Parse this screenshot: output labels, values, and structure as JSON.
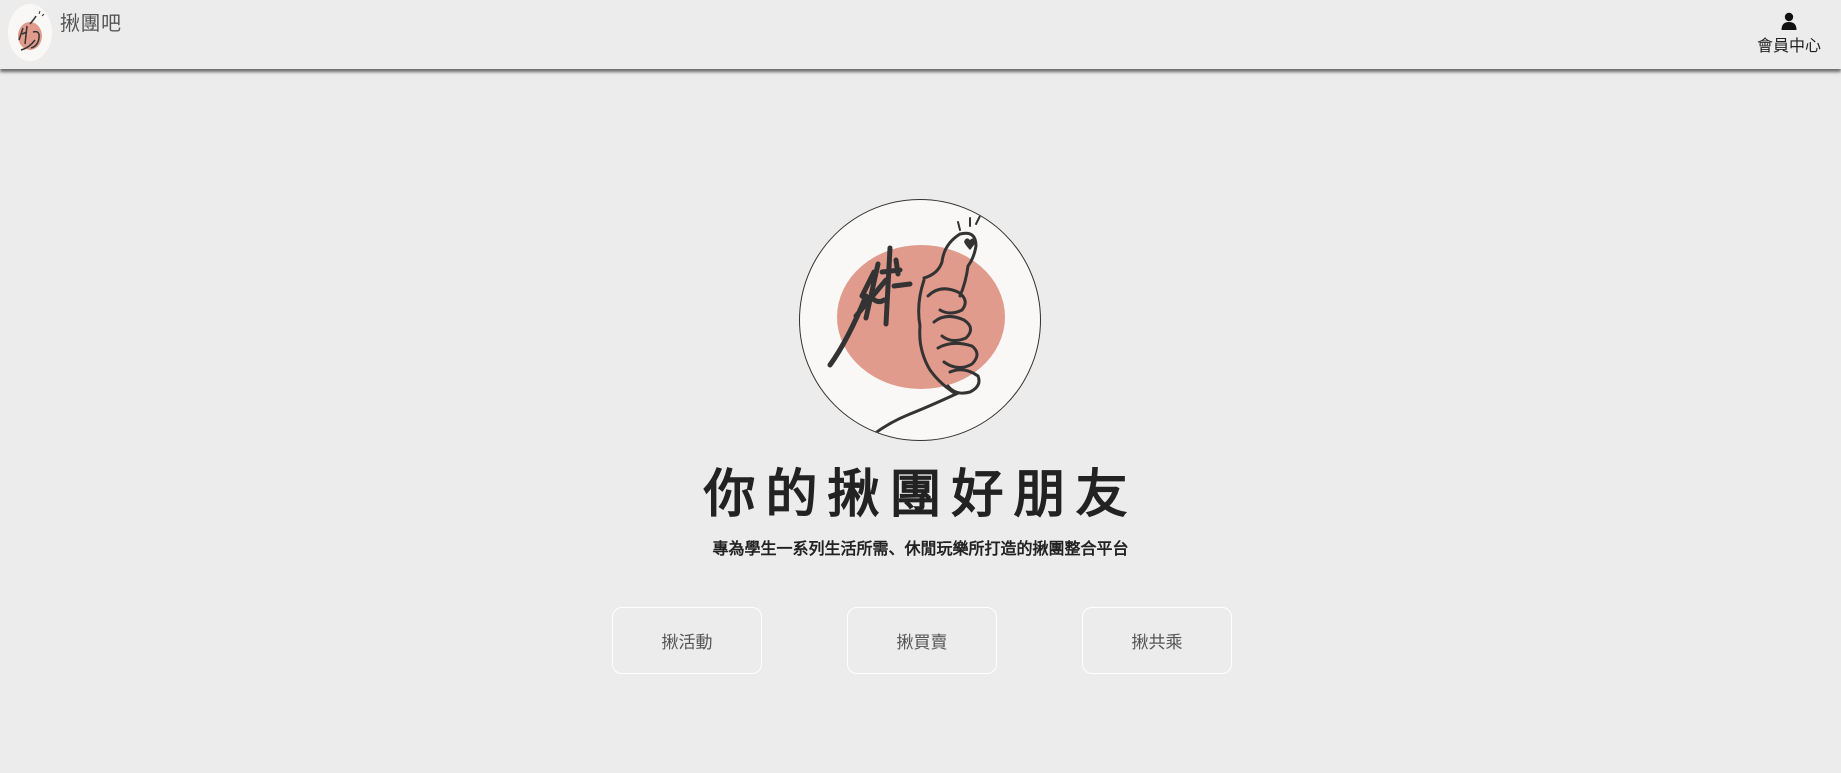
{
  "header": {
    "brand_title": "揪團吧",
    "brand_logo_icon": "thumbs-up-hand-logo-icon",
    "member_icon": "user-icon",
    "member_label": "會員中心"
  },
  "hero": {
    "logo_icon": "thumbs-up-hand-logo-icon",
    "headline": "你的揪團好朋友",
    "subline": "專為學生一系列生活所需、休閒玩樂所打造的揪團整合平台"
  },
  "actions": [
    {
      "label": "揪活動"
    },
    {
      "label": "揪買賣"
    },
    {
      "label": "揪共乘"
    }
  ],
  "colors": {
    "background": "#ececec",
    "accent_blob": "#e19b8c",
    "text": "#222222"
  }
}
